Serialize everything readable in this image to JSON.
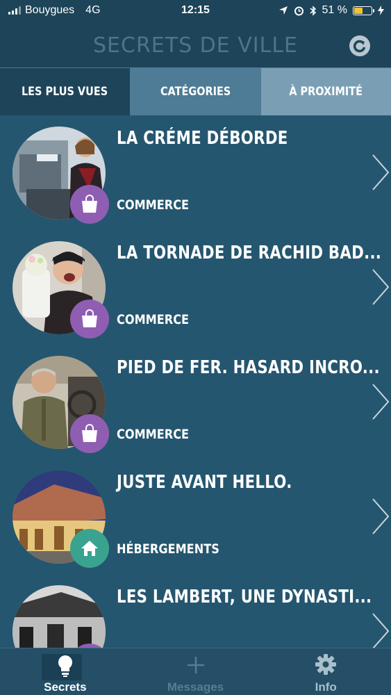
{
  "status_bar": {
    "carrier": "Bouygues",
    "network": "4G",
    "time": "12:15",
    "battery": "51 %"
  },
  "header": {
    "title": "SECRETS DE VILLE",
    "refresh_icon": "refresh-icon"
  },
  "tabs": [
    {
      "label": "LES PLUS VUES"
    },
    {
      "label": "CATÉGORIES"
    },
    {
      "label": "À PROXIMITÉ"
    }
  ],
  "items": [
    {
      "title": "LA CRÉME DÉBORDE",
      "category": "COMMERCE",
      "badge_icon": "shopping-bag-icon"
    },
    {
      "title": "LA TORNADE DE RACHID BAD...",
      "category": "COMMERCE",
      "badge_icon": "shopping-bag-icon"
    },
    {
      "title": "PIED DE FER. HASARD INCRO...",
      "category": "COMMERCE",
      "badge_icon": "shopping-bag-icon"
    },
    {
      "title": "JUSTE AVANT HELLO.",
      "category": "HÉBERGEMENTS",
      "badge_icon": "house-icon"
    },
    {
      "title": "LES LAMBERT, UNE DYNASTI...",
      "category": "",
      "badge_icon": "shopping-bag-icon"
    }
  ],
  "tabbar": [
    {
      "label": "Secrets",
      "icon": "lightbulb-icon"
    },
    {
      "label": "Messages",
      "icon": "plus-icon"
    },
    {
      "label": "Info",
      "icon": "gear-icon"
    }
  ],
  "colors": {
    "background": "#25566f",
    "header": "#1d4459",
    "commerce": "#8f5eb3",
    "hebergements": "#3aa38f"
  }
}
